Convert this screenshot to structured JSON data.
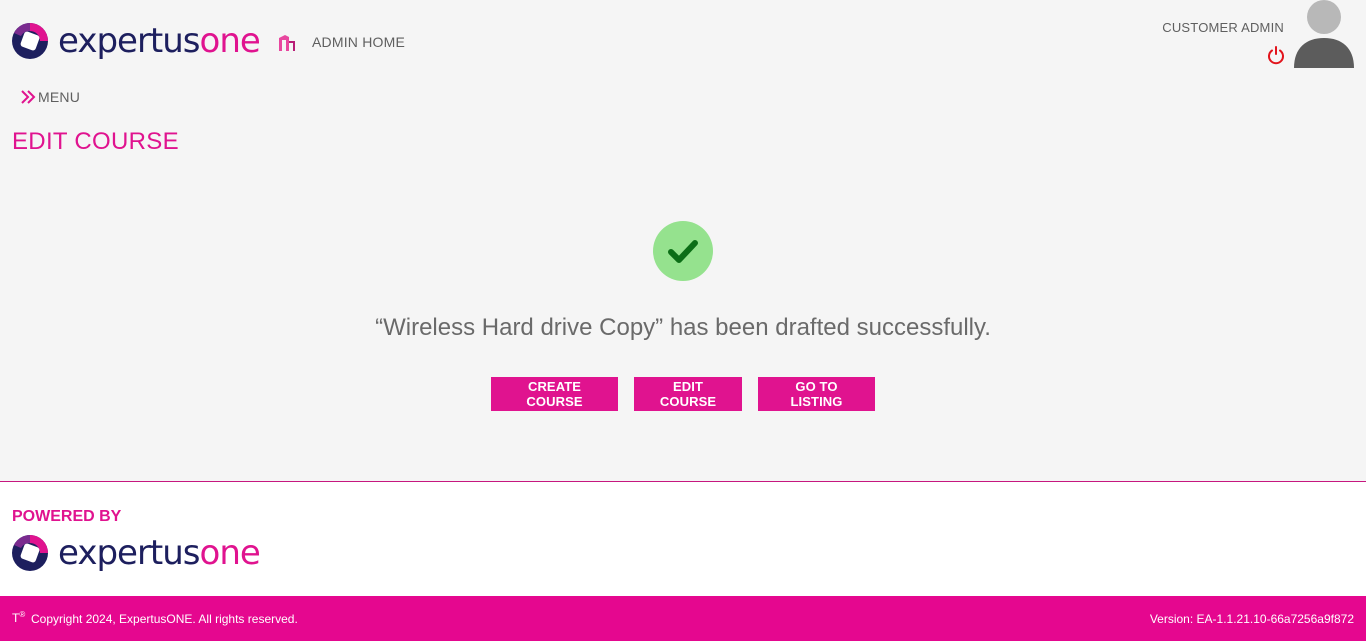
{
  "brand": {
    "name_part1": "expertus",
    "name_part2": "one",
    "primary_color": "#e0138f",
    "dark_color": "#1d1f5e"
  },
  "header": {
    "home_label": "ADMIN HOME",
    "user_role": "CUSTOMER ADMIN",
    "icons": [
      "home-icon",
      "power-icon",
      "avatar-icon"
    ]
  },
  "menu": {
    "label": "MENU"
  },
  "page": {
    "title": "EDIT COURSE"
  },
  "success": {
    "message": "“Wireless Hard drive Copy” has been drafted successfully.",
    "icon": "check-icon",
    "icon_bg": "#95e28e",
    "icon_fg": "#15b515"
  },
  "actions": {
    "create_label": "CREATE COURSE",
    "edit_label": "EDIT COURSE",
    "listing_label": "GO TO LISTING"
  },
  "powered_by": {
    "label": "POWERED BY"
  },
  "footer": {
    "mark": "T",
    "mark_sup": "®",
    "copyright": "Copyright 2024, ExpertusONE. All rights reserved.",
    "version": "Version: EA-1.1.21.10-66a7256a9f872"
  }
}
